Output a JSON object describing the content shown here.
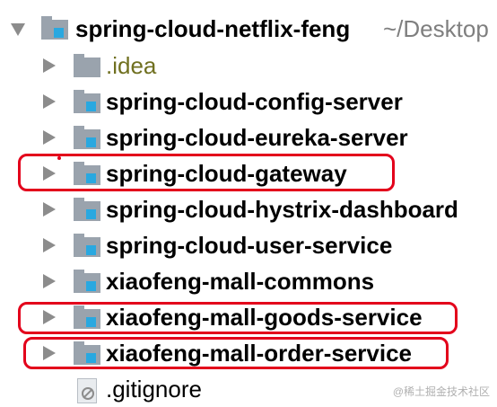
{
  "project": {
    "name": "spring-cloud-netflix-feng",
    "path": "~/Desktop",
    "expanded": true,
    "children": [
      {
        "label": ".idea",
        "kind": "folder-plain"
      },
      {
        "label": "spring-cloud-config-server",
        "kind": "module"
      },
      {
        "label": "spring-cloud-eureka-server",
        "kind": "module"
      },
      {
        "label": "spring-cloud-gateway",
        "kind": "module",
        "highlighted": true
      },
      {
        "label": "spring-cloud-hystrix-dashboard",
        "kind": "module"
      },
      {
        "label": "spring-cloud-user-service",
        "kind": "module"
      },
      {
        "label": "xiaofeng-mall-commons",
        "kind": "module"
      },
      {
        "label": "xiaofeng-mall-goods-service",
        "kind": "module",
        "highlighted": true
      },
      {
        "label": "xiaofeng-mall-order-service",
        "kind": "module",
        "highlighted": true
      },
      {
        "label": ".gitignore",
        "kind": "file"
      }
    ]
  },
  "icons": {
    "collapse": "chevron-down-icon",
    "expand": "chevron-right-icon",
    "module": "module-folder-icon",
    "folder": "folder-icon",
    "file": "ignore-file-icon"
  },
  "colors": {
    "highlight": "#e3001b",
    "folder": "#9aa3ad",
    "module_badge": "#29a8e0",
    "path_text": "#7f7f7f"
  },
  "watermark": "@稀土掘金技术社区"
}
